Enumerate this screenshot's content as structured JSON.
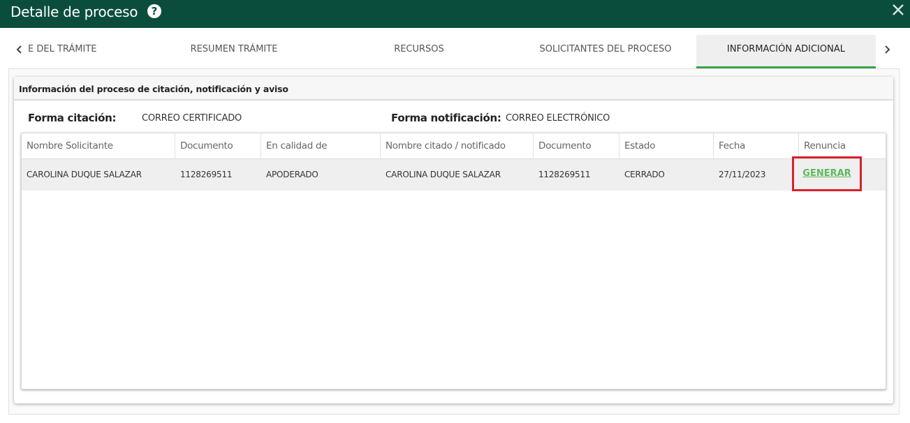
{
  "window": {
    "title": "Detalle de proceso"
  },
  "tabs": [
    {
      "label": "E DEL TRÁMITE",
      "active": false
    },
    {
      "label": "RESUMEN TRÁMITE",
      "active": false
    },
    {
      "label": "RECURSOS",
      "active": false
    },
    {
      "label": "SOLICITANTES DEL PROCESO",
      "active": false
    },
    {
      "label": "INFORMACIÓN ADICIONAL",
      "active": true
    }
  ],
  "section": {
    "title": "Información del proceso de citación, notificación y aviso",
    "forma_citacion_label": "Forma citación:",
    "forma_citacion_value": "CORREO CERTIFICADO",
    "forma_notificacion_label": "Forma notificación:",
    "forma_notificacion_value": "CORREO ELECTRÓNICO"
  },
  "table": {
    "headers": [
      "Nombre Solicitante",
      "Documento",
      "En calidad de",
      "Nombre citado / notificado",
      "Documento",
      "Estado",
      "Fecha",
      "Renuncia"
    ],
    "rows": [
      [
        "CAROLINA DUQUE SALAZAR",
        "1128269511",
        "APODERADO",
        "CAROLINA DUQUE SALAZAR",
        "1128269511",
        "CERRADO",
        "27/11/2023",
        "GENERAR"
      ]
    ]
  },
  "colors": {
    "titlebar": "#0b4d3c",
    "active_tab_indicator": "#3ba34b",
    "link": "#5cb85c",
    "highlight_box": "#d8202c"
  },
  "icons": {
    "help": "question-circle-icon",
    "close": "close-icon",
    "prev": "chevron-left-icon",
    "next": "chevron-right-icon"
  }
}
